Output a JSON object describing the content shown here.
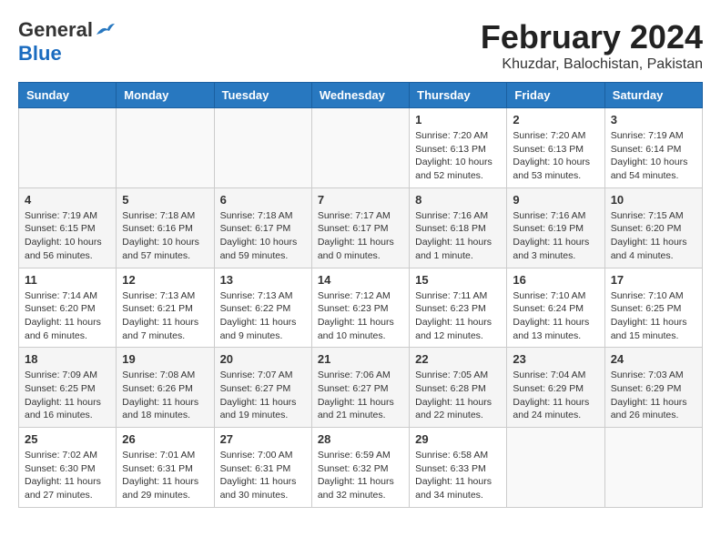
{
  "header": {
    "logo_line1": "General",
    "logo_line2": "Blue",
    "title": "February 2024",
    "subtitle": "Khuzdar, Balochistan, Pakistan"
  },
  "calendar": {
    "days_of_week": [
      "Sunday",
      "Monday",
      "Tuesday",
      "Wednesday",
      "Thursday",
      "Friday",
      "Saturday"
    ],
    "weeks": [
      [
        {
          "day": "",
          "info": ""
        },
        {
          "day": "",
          "info": ""
        },
        {
          "day": "",
          "info": ""
        },
        {
          "day": "",
          "info": ""
        },
        {
          "day": "1",
          "info": "Sunrise: 7:20 AM\nSunset: 6:13 PM\nDaylight: 10 hours\nand 52 minutes."
        },
        {
          "day": "2",
          "info": "Sunrise: 7:20 AM\nSunset: 6:13 PM\nDaylight: 10 hours\nand 53 minutes."
        },
        {
          "day": "3",
          "info": "Sunrise: 7:19 AM\nSunset: 6:14 PM\nDaylight: 10 hours\nand 54 minutes."
        }
      ],
      [
        {
          "day": "4",
          "info": "Sunrise: 7:19 AM\nSunset: 6:15 PM\nDaylight: 10 hours\nand 56 minutes."
        },
        {
          "day": "5",
          "info": "Sunrise: 7:18 AM\nSunset: 6:16 PM\nDaylight: 10 hours\nand 57 minutes."
        },
        {
          "day": "6",
          "info": "Sunrise: 7:18 AM\nSunset: 6:17 PM\nDaylight: 10 hours\nand 59 minutes."
        },
        {
          "day": "7",
          "info": "Sunrise: 7:17 AM\nSunset: 6:17 PM\nDaylight: 11 hours\nand 0 minutes."
        },
        {
          "day": "8",
          "info": "Sunrise: 7:16 AM\nSunset: 6:18 PM\nDaylight: 11 hours\nand 1 minute."
        },
        {
          "day": "9",
          "info": "Sunrise: 7:16 AM\nSunset: 6:19 PM\nDaylight: 11 hours\nand 3 minutes."
        },
        {
          "day": "10",
          "info": "Sunrise: 7:15 AM\nSunset: 6:20 PM\nDaylight: 11 hours\nand 4 minutes."
        }
      ],
      [
        {
          "day": "11",
          "info": "Sunrise: 7:14 AM\nSunset: 6:20 PM\nDaylight: 11 hours\nand 6 minutes."
        },
        {
          "day": "12",
          "info": "Sunrise: 7:13 AM\nSunset: 6:21 PM\nDaylight: 11 hours\nand 7 minutes."
        },
        {
          "day": "13",
          "info": "Sunrise: 7:13 AM\nSunset: 6:22 PM\nDaylight: 11 hours\nand 9 minutes."
        },
        {
          "day": "14",
          "info": "Sunrise: 7:12 AM\nSunset: 6:23 PM\nDaylight: 11 hours\nand 10 minutes."
        },
        {
          "day": "15",
          "info": "Sunrise: 7:11 AM\nSunset: 6:23 PM\nDaylight: 11 hours\nand 12 minutes."
        },
        {
          "day": "16",
          "info": "Sunrise: 7:10 AM\nSunset: 6:24 PM\nDaylight: 11 hours\nand 13 minutes."
        },
        {
          "day": "17",
          "info": "Sunrise: 7:10 AM\nSunset: 6:25 PM\nDaylight: 11 hours\nand 15 minutes."
        }
      ],
      [
        {
          "day": "18",
          "info": "Sunrise: 7:09 AM\nSunset: 6:25 PM\nDaylight: 11 hours\nand 16 minutes."
        },
        {
          "day": "19",
          "info": "Sunrise: 7:08 AM\nSunset: 6:26 PM\nDaylight: 11 hours\nand 18 minutes."
        },
        {
          "day": "20",
          "info": "Sunrise: 7:07 AM\nSunset: 6:27 PM\nDaylight: 11 hours\nand 19 minutes."
        },
        {
          "day": "21",
          "info": "Sunrise: 7:06 AM\nSunset: 6:27 PM\nDaylight: 11 hours\nand 21 minutes."
        },
        {
          "day": "22",
          "info": "Sunrise: 7:05 AM\nSunset: 6:28 PM\nDaylight: 11 hours\nand 22 minutes."
        },
        {
          "day": "23",
          "info": "Sunrise: 7:04 AM\nSunset: 6:29 PM\nDaylight: 11 hours\nand 24 minutes."
        },
        {
          "day": "24",
          "info": "Sunrise: 7:03 AM\nSunset: 6:29 PM\nDaylight: 11 hours\nand 26 minutes."
        }
      ],
      [
        {
          "day": "25",
          "info": "Sunrise: 7:02 AM\nSunset: 6:30 PM\nDaylight: 11 hours\nand 27 minutes."
        },
        {
          "day": "26",
          "info": "Sunrise: 7:01 AM\nSunset: 6:31 PM\nDaylight: 11 hours\nand 29 minutes."
        },
        {
          "day": "27",
          "info": "Sunrise: 7:00 AM\nSunset: 6:31 PM\nDaylight: 11 hours\nand 30 minutes."
        },
        {
          "day": "28",
          "info": "Sunrise: 6:59 AM\nSunset: 6:32 PM\nDaylight: 11 hours\nand 32 minutes."
        },
        {
          "day": "29",
          "info": "Sunrise: 6:58 AM\nSunset: 6:33 PM\nDaylight: 11 hours\nand 34 minutes."
        },
        {
          "day": "",
          "info": ""
        },
        {
          "day": "",
          "info": ""
        }
      ]
    ]
  }
}
